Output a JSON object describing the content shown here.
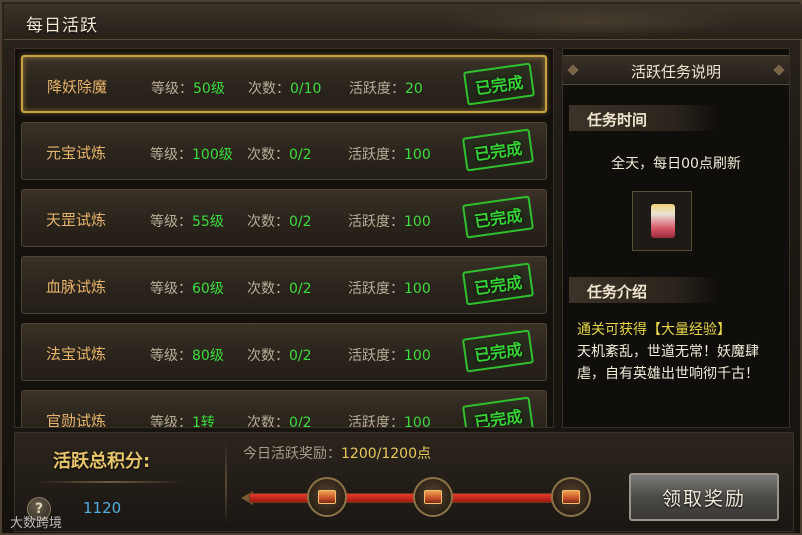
{
  "window": {
    "title": "每日活跃"
  },
  "tasks": [
    {
      "name": "降妖除魔",
      "level_label": "等级：",
      "level": "50级",
      "count_label": "次数：",
      "count": "0/10",
      "activity_label": "活跃度：",
      "activity": "20",
      "status": "已完成",
      "selected": true
    },
    {
      "name": "元宝试炼",
      "level_label": "等级：",
      "level": "100级",
      "count_label": "次数：",
      "count": "0/2",
      "activity_label": "活跃度：",
      "activity": "100",
      "status": "已完成",
      "selected": false
    },
    {
      "name": "天罡试炼",
      "level_label": "等级：",
      "level": "55级",
      "count_label": "次数：",
      "count": "0/2",
      "activity_label": "活跃度：",
      "activity": "100",
      "status": "已完成",
      "selected": false
    },
    {
      "name": "血脉试炼",
      "level_label": "等级：",
      "level": "60级",
      "count_label": "次数：",
      "count": "0/2",
      "activity_label": "活跃度：",
      "activity": "100",
      "status": "已完成",
      "selected": false
    },
    {
      "name": "法宝试炼",
      "level_label": "等级：",
      "level": "80级",
      "count_label": "次数：",
      "count": "0/2",
      "activity_label": "活跃度：",
      "activity": "100",
      "status": "已完成",
      "selected": false
    },
    {
      "name": "官勋试炼",
      "level_label": "等级：",
      "level": "1转",
      "count_label": "次数：",
      "count": "0/2",
      "activity_label": "活跃度：",
      "activity": "100",
      "status": "已完成",
      "selected": false
    }
  ],
  "info": {
    "header": "活跃任务说明",
    "time_title": "任务时间",
    "time_text": "全天，每日00点刷新",
    "intro_title": "任务介绍",
    "intro_highlight": "通关可获得【大量经验】",
    "intro_text": "天机紊乱，世道无常！妖魔肆虐，自有英雄出世响彻千古！"
  },
  "bottom": {
    "score_label": "活跃总积分:",
    "score_value": "1120",
    "help_label": "?",
    "reward_label": "今日活跃奖励：",
    "reward_value": "1200/1200点",
    "progress_fraction": 1.0,
    "claim_label": "领取奖励"
  },
  "watermark": "大数跨境",
  "colors": {
    "accent_gold": "#c9a043",
    "complete_green": "#36d236",
    "value_green": "#3ddc3d"
  }
}
